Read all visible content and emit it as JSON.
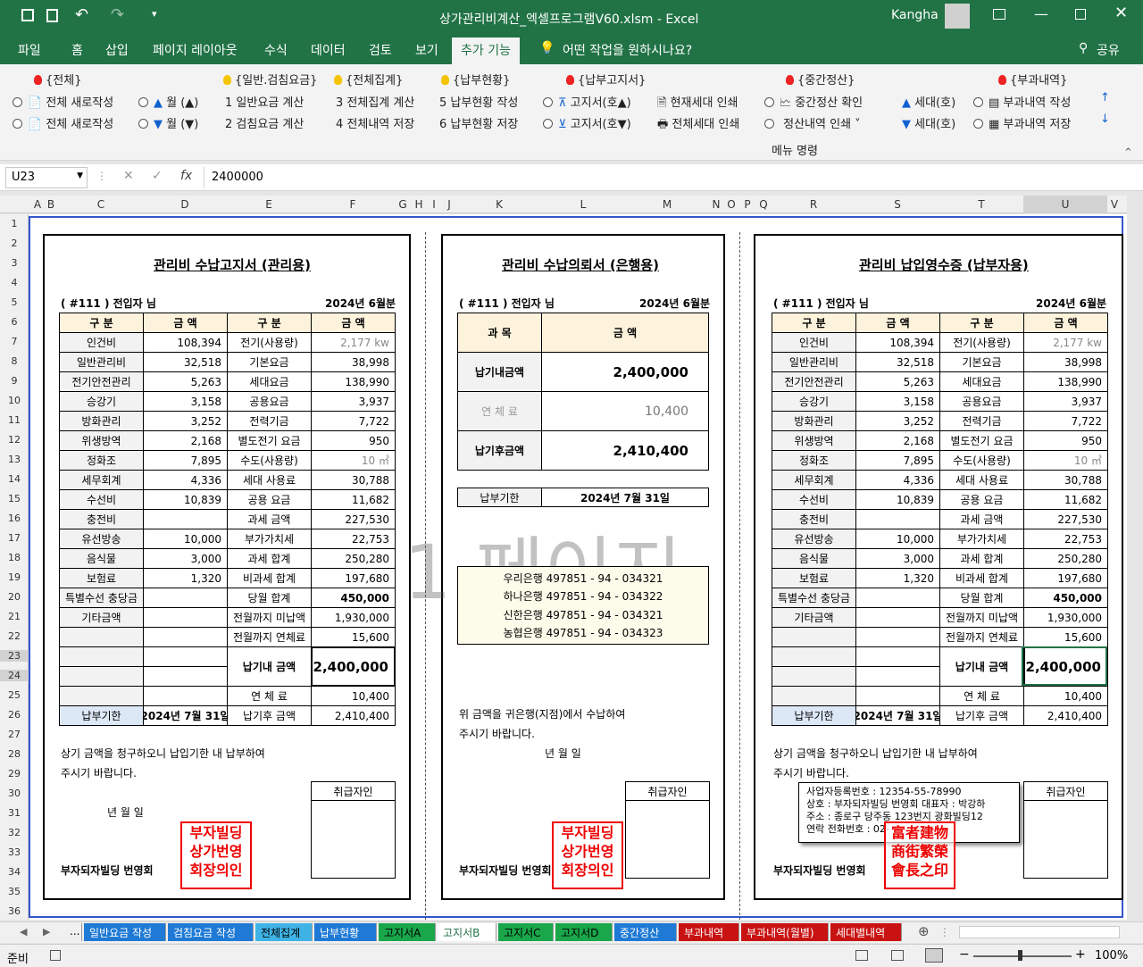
{
  "window": {
    "title": "상가관리비계산_엑셀프로그램V60.xlsm  -  Excel",
    "user": "Kangha"
  },
  "menu": [
    "파일",
    "홈",
    "삽입",
    "페이지 레이아웃",
    "수식",
    "데이터",
    "검토",
    "보기",
    "추가 기능",
    "어떤 작업을 원하시나요?",
    "공유"
  ],
  "ribbon": {
    "groups": [
      "{전체}",
      "{일반.검침요금}",
      "{전체집계}",
      "{납부현황}",
      "{납부고지서}",
      "{중간정산}",
      "{부과내역}"
    ],
    "row1": [
      "전체 새로작성",
      "월 (▲)",
      "1  일반요금 계산",
      "3  전체집계 계산",
      "5  납부현황 작성",
      "고지서(호▲)",
      "현재세대 인쇄",
      "중간정산 확인",
      "세대(호)",
      "부과내역 작성"
    ],
    "row2": [
      "전체 새로작성",
      "월 (▼)",
      "2  검침요금 계산",
      "4  전체내역 저장",
      "6  납부현황 저장",
      "고지서(호▼)",
      "전체세대 인쇄",
      "정산내역 인쇄",
      "세대(호)",
      "부과내역 저장"
    ],
    "footer": "메뉴 명령"
  },
  "formula": {
    "namebox": "U23",
    "value": "2400000"
  },
  "columns": [
    "A",
    "B",
    "C",
    "D",
    "E",
    "F",
    "G",
    "H",
    "I",
    "J",
    "K",
    "L",
    "M",
    "N",
    "O",
    "P",
    "Q",
    "R",
    "S",
    "T",
    "U",
    "V"
  ],
  "rows": [
    "1",
    "2",
    "3",
    "4",
    "5",
    "6",
    "7",
    "8",
    "9",
    "10",
    "11",
    "12",
    "13",
    "14",
    "15",
    "16",
    "17",
    "18",
    "19",
    "20",
    "21",
    "22",
    "23",
    "24",
    "25",
    "26",
    "27",
    "28",
    "29",
    "30",
    "31",
    "32",
    "33",
    "34",
    "35",
    "36"
  ],
  "watermark": "1 페이지",
  "notice": {
    "title1": "관리비 수납고지서 (관리용)",
    "title3": "관리비 납입영수증 (납부자용)",
    "tenant": "( #111 )  전입자 님",
    "period": "2024년 6월분",
    "headers": [
      "구 분",
      "금 액",
      "구 분",
      "금 액"
    ],
    "left": [
      [
        "인건비",
        "108,394"
      ],
      [
        "일반관리비",
        "32,518"
      ],
      [
        "전기안전관리",
        "5,263"
      ],
      [
        "승강기",
        "3,158"
      ],
      [
        "방화관리",
        "3,252"
      ],
      [
        "위생방역",
        "2,168"
      ],
      [
        "정화조",
        "7,895"
      ],
      [
        "세무회계",
        "4,336"
      ],
      [
        "수선비",
        "10,839"
      ],
      [
        "충전비",
        ""
      ],
      [
        "유선방송",
        "10,000"
      ],
      [
        "음식물",
        "3,000"
      ],
      [
        "보험료",
        "1,320"
      ],
      [
        "특별수선 충당금",
        ""
      ],
      [
        "기타금액",
        ""
      ]
    ],
    "right": [
      [
        "전기(사용량)",
        "2,177 kw"
      ],
      [
        "기본요금",
        "38,998"
      ],
      [
        "세대요금",
        "138,990"
      ],
      [
        "공용요금",
        "3,937"
      ],
      [
        "전력기금",
        "7,722"
      ],
      [
        "별도전기 요금",
        "950"
      ],
      [
        "수도(사용량)",
        "10 ㎥"
      ],
      [
        "세대 사용료",
        "30,788"
      ],
      [
        "공용 요금",
        "11,682"
      ],
      [
        "과세 금액",
        "227,530"
      ],
      [
        "부가가치세",
        "22,753"
      ],
      [
        "과세 합계",
        "250,280"
      ],
      [
        "비과세 합계",
        "197,680"
      ],
      [
        "당월 합계",
        "450,000"
      ],
      [
        "전월까지 미납액",
        "1,930,000"
      ],
      [
        "전월까지 연체료",
        "15,600"
      ]
    ],
    "pay_label": "납기내 금액",
    "pay_value": "2,400,000",
    "late_label": "연  체  료",
    "late_value": "10,400",
    "due_label": "납부기한",
    "due_value": "2024년 7월 31일",
    "after_label": "납기후 금액",
    "after_value": "2,410,400",
    "msg1": "상기 금액을 청구하오니 납입기한 내 납부하여",
    "msg2": "주시기 바랍니다.",
    "ymd": "년     월     일",
    "handler": "취급자인",
    "owner": "부자되자빌딩 번영회",
    "stamp": [
      "부자빌딩",
      "상가번영",
      "회장의인"
    ],
    "stamp_cn": [
      "富者建物",
      "商街繁榮",
      "會長之印"
    ]
  },
  "bank": {
    "title": "관리비 수납의뢰서 (은행용)",
    "tenant": "( #111 )  전입자 님",
    "period": "2024년 6월분",
    "col1": "과   목",
    "col2": "금   액",
    "items": [
      [
        "납기내금액",
        "2,400,000"
      ],
      [
        "연   체   료",
        "10,400"
      ],
      [
        "납기후금액",
        "2,410,400"
      ]
    ],
    "due_label": "납부기한",
    "due_value": "2024년 7월 31일",
    "accounts": [
      "우리은행 497851 - 94 - 034321",
      "하나은행 497851 - 94 - 034322",
      "신한은행 497851 - 94 - 034321",
      "농협은행 497851 - 94 - 034323"
    ],
    "msg1": "위 금액을 귀은행(지점)에서 수납하여",
    "msg2": "주시기 바랍니다.",
    "ymd": "년       월       일"
  },
  "business": [
    "사업자등록번호 : 12354-55-78990",
    "상호 : 부자되자빌딩 번영회   대표자 : 박강하",
    "주소 : 종로구 당주동 123번지 광화빌딩12",
    "연락 전화번호 : 02-"
  ],
  "sheets": [
    "...",
    "일반요금 작성",
    "검침요금 작성",
    "전체집계",
    "납부현황",
    "고지서A",
    "고지서B",
    "고지서C",
    "고지서D",
    "중간정산",
    "부과내역",
    "부과내역(월별)",
    "세대별내역"
  ],
  "status": {
    "ready": "준비",
    "zoom": "100%"
  }
}
